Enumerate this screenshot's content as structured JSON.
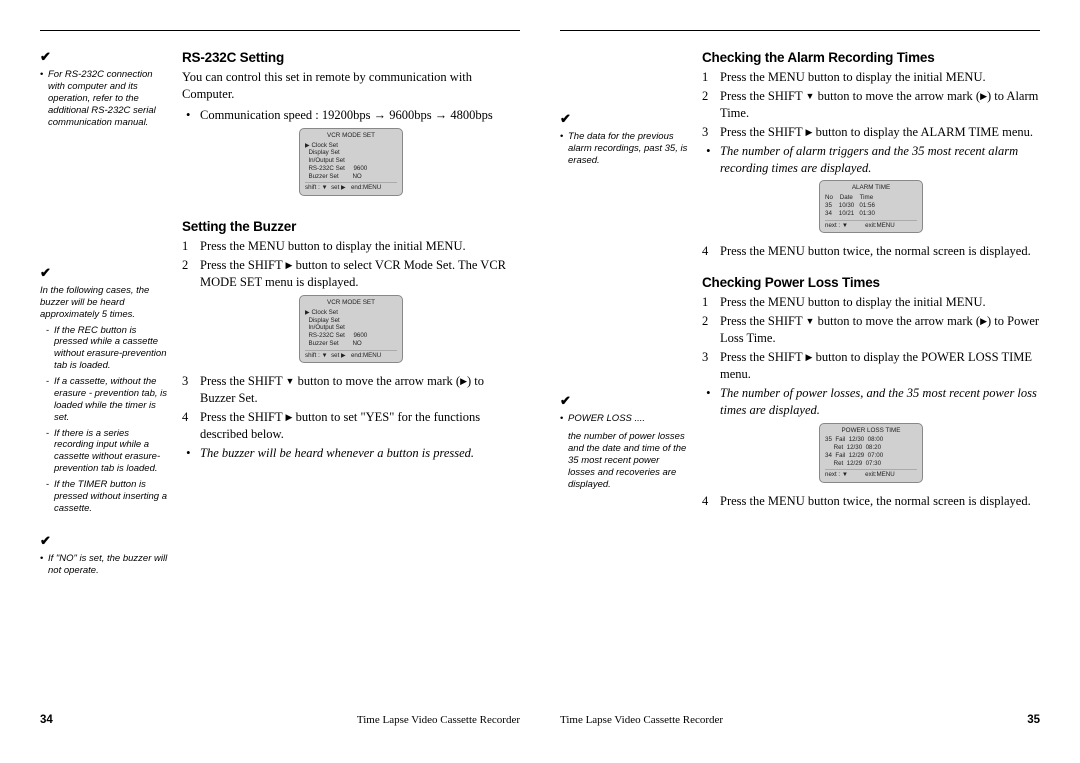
{
  "page_left": {
    "side_note_1_bullet": "For RS-232C connection with computer and its operation, refer to the additional RS-232C serial communication manual.",
    "side_note_2_intro": "In the following cases, the buzzer will be heard approximately 5 times.",
    "side_note_2_items": [
      "If the REC button is pressed while a cassette without erasure-prevention tab is loaded.",
      "If a cassette, without the erasure - prevention tab, is loaded while the timer is set.",
      "If there is a series recording input while a cassette without erasure-prevention tab is loaded.",
      "If the TIMER button is pressed without inserting a cassette."
    ],
    "side_note_3_bullet": "If \"NO\" is set, the buzzer will not operate.",
    "sec1_title": "RS-232C Setting",
    "sec1_para": "You can control this set in remote by communication with Computer.",
    "sec1_bullet": "Communication speed : 19200bps  →  9600bps  →  4800bps",
    "menu1": {
      "title": "VCR MODE SET",
      "rows": [
        "▶ Clock Set",
        "  Display Set",
        "  In/Output Set",
        "  RS-232C Set     9600",
        "  Buzzer Set        NO"
      ],
      "footer": "shift : ▼  set ▶   end:MENU"
    },
    "sec2_title": "Setting the Buzzer",
    "sec2_step1": "Press the MENU button to display the initial MENU.",
    "sec2_step2a": "Press the SHIFT ",
    "sec2_step2b": " button to select VCR Mode Set. The VCR MODE SET menu is displayed.",
    "sec2_step3a": "Press the SHIFT ",
    "sec2_step3b": " button to move the arrow mark (",
    "sec2_step3c": ") to Buzzer Set.",
    "sec2_step4a": "Press the SHIFT ",
    "sec2_step4b": " button to set \"YES\" for the functions described below.",
    "sec2_note": "The buzzer will be heard whenever a button is pressed.",
    "footer_title": "Time Lapse Video Cassette Recorder",
    "page_no": "34"
  },
  "page_right": {
    "side_note_1_bullet": "The data for the previous alarm recordings, past 35, is erased.",
    "side_note_2_head": "POWER LOSS ....",
    "side_note_2_body": "the number of power losses and the date and time of the 35 most recent power losses and recoveries are displayed.",
    "sec1_title": "Checking the Alarm Recording Times",
    "sec1_step1": "Press the MENU button to display the initial MENU.",
    "sec1_step2a": "Press the SHIFT ",
    "sec1_step2b": " button to move the arrow mark (",
    "sec1_step2c": ") to  Alarm Time.",
    "sec1_step3a": "Press the SHIFT ",
    "sec1_step3b": " button to display the ALARM TIME menu.",
    "sec1_note": "The number of alarm triggers and the 35 most recent alarm recording times are displayed.",
    "menu1": {
      "title": "ALARM TIME",
      "rows": [
        "No    Date    Time",
        "35    10/30   01:56",
        "34    10/21   01:30"
      ],
      "footer": "next : ▼          exit:MENU"
    },
    "sec1_step4": "Press the MENU button twice, the normal screen is displayed.",
    "sec2_title": "Checking Power Loss Times",
    "sec2_step1": "Press the MENU button to display the initial MENU.",
    "sec2_step2a": "Press the SHIFT ",
    "sec2_step2b": " button to move the arrow mark (",
    "sec2_step2c": ") to Power Loss Time.",
    "sec2_step3a": "Press the SHIFT ",
    "sec2_step3b": " button to display the POWER LOSS TIME menu.",
    "sec2_note": "The number of power losses, and the 35 most recent power loss times are displayed.",
    "menu2": {
      "title": "POWER LOSS TIME",
      "rows": [
        "35  Fail  12/30  08:00",
        "     Ret  12/30  08:20",
        "34  Fail  12/29  07:00",
        "     Ret  12/29  07:30"
      ],
      "footer": "next : ▼          exit:MENU"
    },
    "sec2_step4": "Press the MENU button twice, the normal screen  is displayed.",
    "footer_title": "Time Lapse Video Cassette Recorder",
    "page_no": "35"
  }
}
